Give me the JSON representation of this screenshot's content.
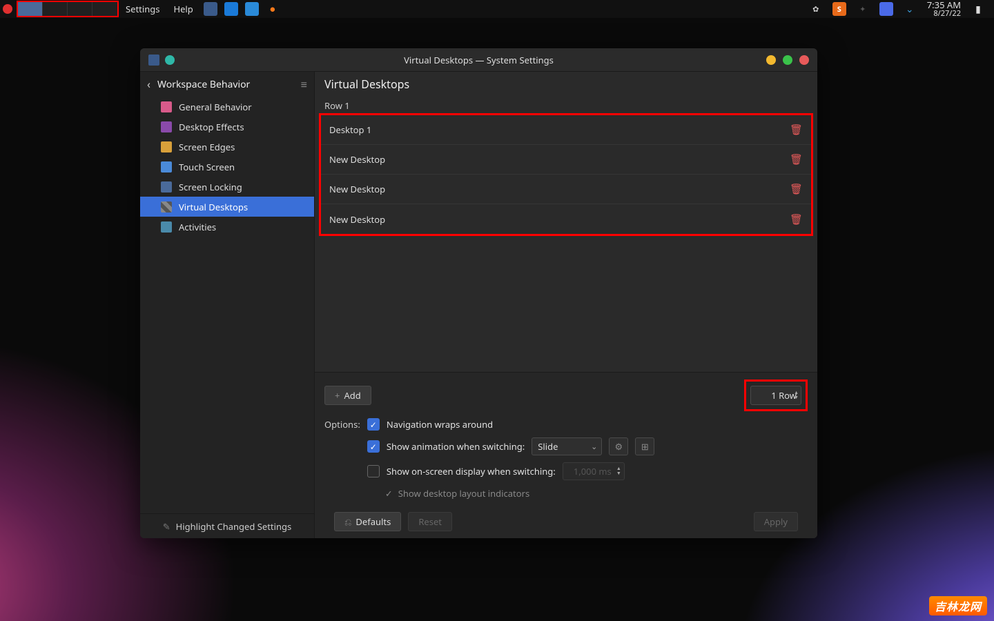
{
  "panel": {
    "menus": [
      "Settings",
      "Help"
    ],
    "pager_cells": 4,
    "clock_time": "7:35 AM",
    "clock_date": "8/27/22"
  },
  "window": {
    "title": "Virtual Desktops — System Settings",
    "sidebar": {
      "back_label": "Workspace Behavior",
      "items": [
        {
          "label": "General Behavior"
        },
        {
          "label": "Desktop Effects"
        },
        {
          "label": "Screen Edges"
        },
        {
          "label": "Touch Screen"
        },
        {
          "label": "Screen Locking"
        },
        {
          "label": "Virtual Desktops"
        },
        {
          "label": "Activities"
        }
      ],
      "footer": "Highlight Changed Settings"
    },
    "main": {
      "title": "Virtual Desktops",
      "row_label": "Row 1",
      "desktops": [
        {
          "name": "Desktop 1"
        },
        {
          "name": "New Desktop"
        },
        {
          "name": "New Desktop"
        },
        {
          "name": "New Desktop"
        }
      ],
      "add_button": "Add",
      "row_spinner": "1 Row",
      "options_label": "Options:",
      "opt_wrap": "Navigation wraps around",
      "opt_anim_label": "Show animation when switching:",
      "opt_anim_value": "Slide",
      "opt_osd": "Show on-screen display when switching:",
      "opt_osd_ms": "1,000 ms",
      "opt_indicators": "Show desktop layout indicators",
      "defaults": "Defaults",
      "reset": "Reset",
      "apply": "Apply"
    }
  },
  "watermark": "吉林龙网"
}
